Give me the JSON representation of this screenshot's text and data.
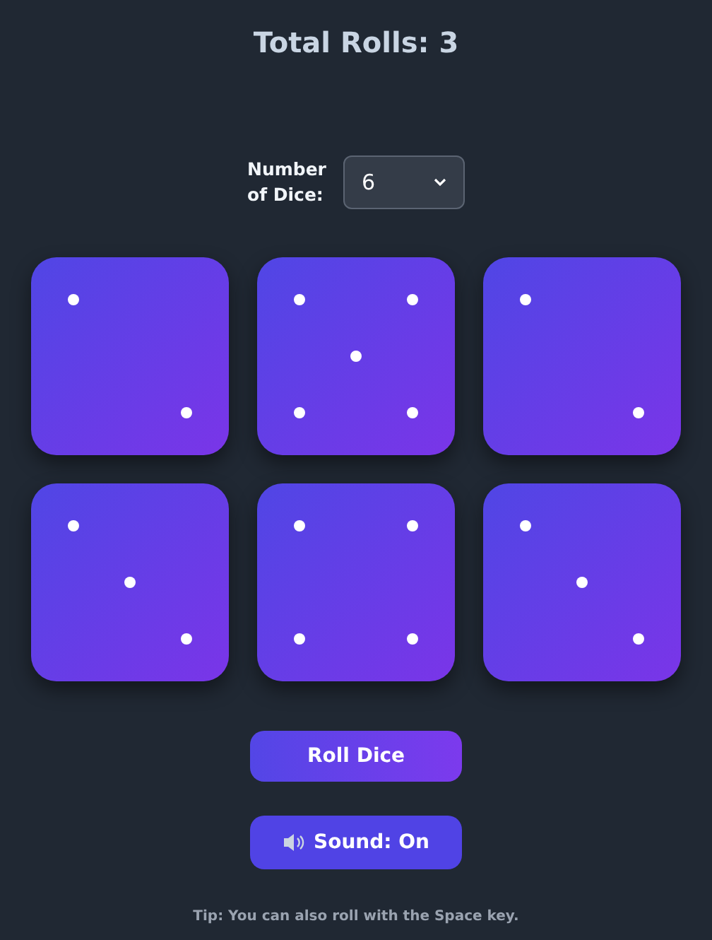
{
  "title": "Total Rolls: 3",
  "dice_count": {
    "label": "Number of Dice:",
    "value": "6"
  },
  "dice": [
    {
      "kind": "two"
    },
    {
      "kind": "five"
    },
    {
      "kind": "two"
    },
    {
      "kind": "three"
    },
    {
      "kind": "four"
    },
    {
      "kind": "three"
    }
  ],
  "roll_button": "Roll Dice",
  "sound_button": {
    "label": "Sound: On"
  },
  "tip": "Tip: You can also roll with the Space key."
}
